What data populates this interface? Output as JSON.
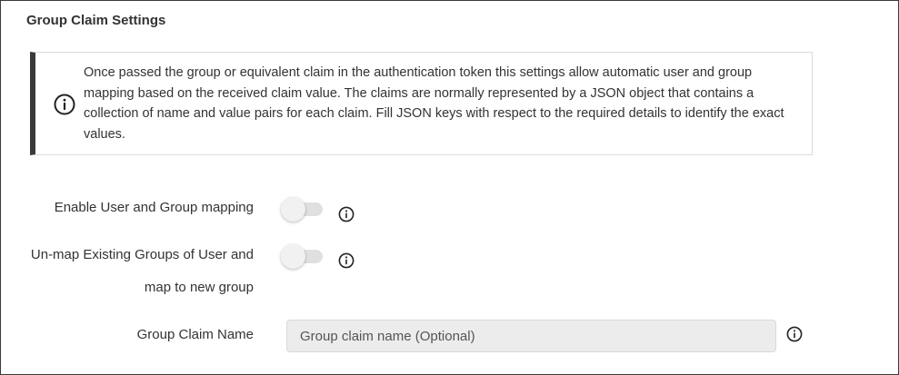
{
  "section": {
    "title": "Group Claim Settings"
  },
  "info_box": {
    "icon": "info-circle-icon",
    "text": "Once passed the group or equivalent claim in the authentication token this settings allow automatic user and group mapping based on the received claim value. The claims are normally represented by a JSON object that contains a collection of name and value pairs for each claim. Fill JSON keys with respect to the required details to identify the exact values."
  },
  "settings": {
    "enable_mapping": {
      "label": "Enable User and Group mapping",
      "enabled": false,
      "help_icon": "info-circle-icon"
    },
    "unmap_groups": {
      "label": "Un-map Existing Groups of User and map to new group",
      "enabled": false,
      "help_icon": "info-circle-icon"
    },
    "group_claim_name": {
      "label": "Group Claim Name",
      "value": "",
      "placeholder": "Group claim name (Optional)",
      "help_icon": "info-circle-icon"
    }
  },
  "colors": {
    "info_accent": "#3a3a3a",
    "toggle_off_track": "#e0e0e0",
    "input_background": "#ececec"
  }
}
